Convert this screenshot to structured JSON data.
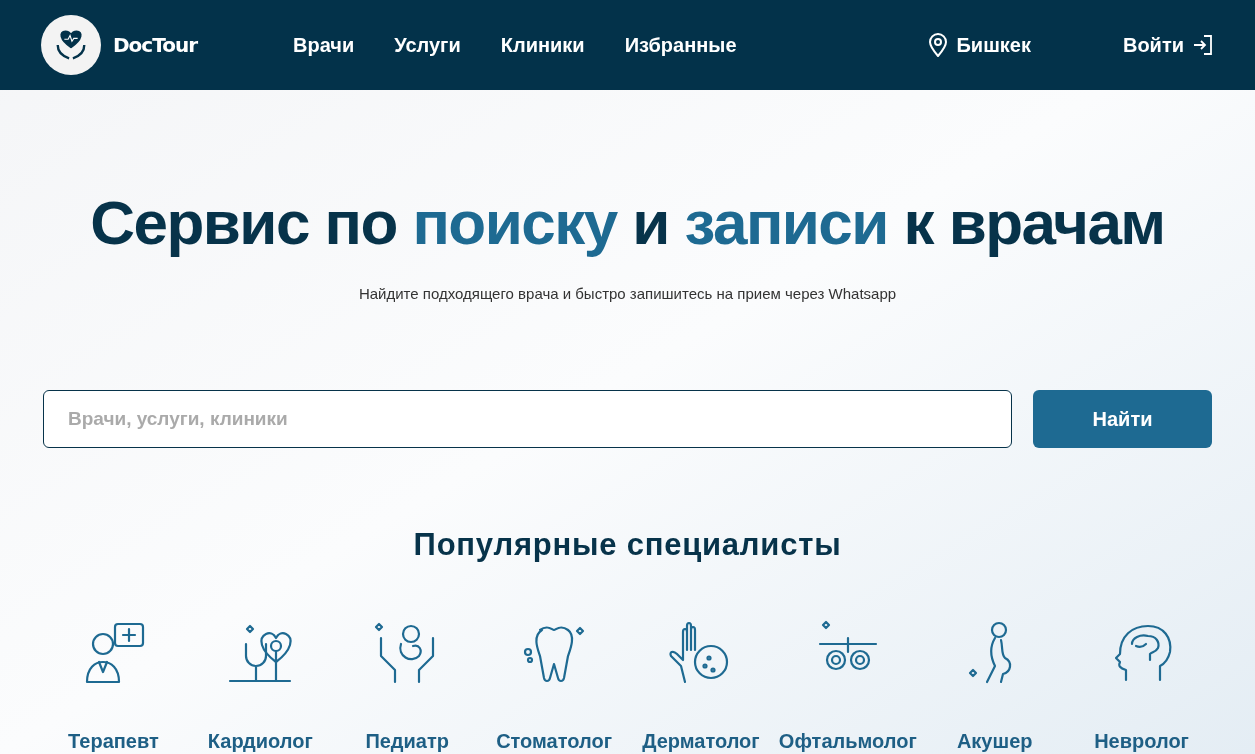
{
  "header": {
    "logo_text": "DocTour",
    "nav": [
      {
        "label": "Врачи"
      },
      {
        "label": "Услуги"
      },
      {
        "label": "Клиники"
      },
      {
        "label": "Избранные"
      }
    ],
    "city": "Бишкек",
    "login": "Войти"
  },
  "hero": {
    "title": [
      {
        "text": "Сервис по ",
        "accent": false
      },
      {
        "text": "поиску",
        "accent": true
      },
      {
        "text": " и ",
        "accent": false
      },
      {
        "text": "записи",
        "accent": true
      },
      {
        "text": " к врачам",
        "accent": false
      }
    ],
    "subtitle": "Найдите подходящего врача и быстро запишитесь на прием через Whatsapp"
  },
  "search": {
    "placeholder": "Врачи, услуги, клиники",
    "button": "Найти"
  },
  "popular": {
    "title": "Популярные специалисты",
    "items": [
      {
        "label": "Терапевт"
      },
      {
        "label": "Кардиолог"
      },
      {
        "label": "Педиатр"
      },
      {
        "label": "Стоматолог"
      },
      {
        "label": "Дерматолог"
      },
      {
        "label": "Офтальмолог"
      },
      {
        "label": "Акушер"
      },
      {
        "label": "Невролог"
      }
    ]
  }
}
